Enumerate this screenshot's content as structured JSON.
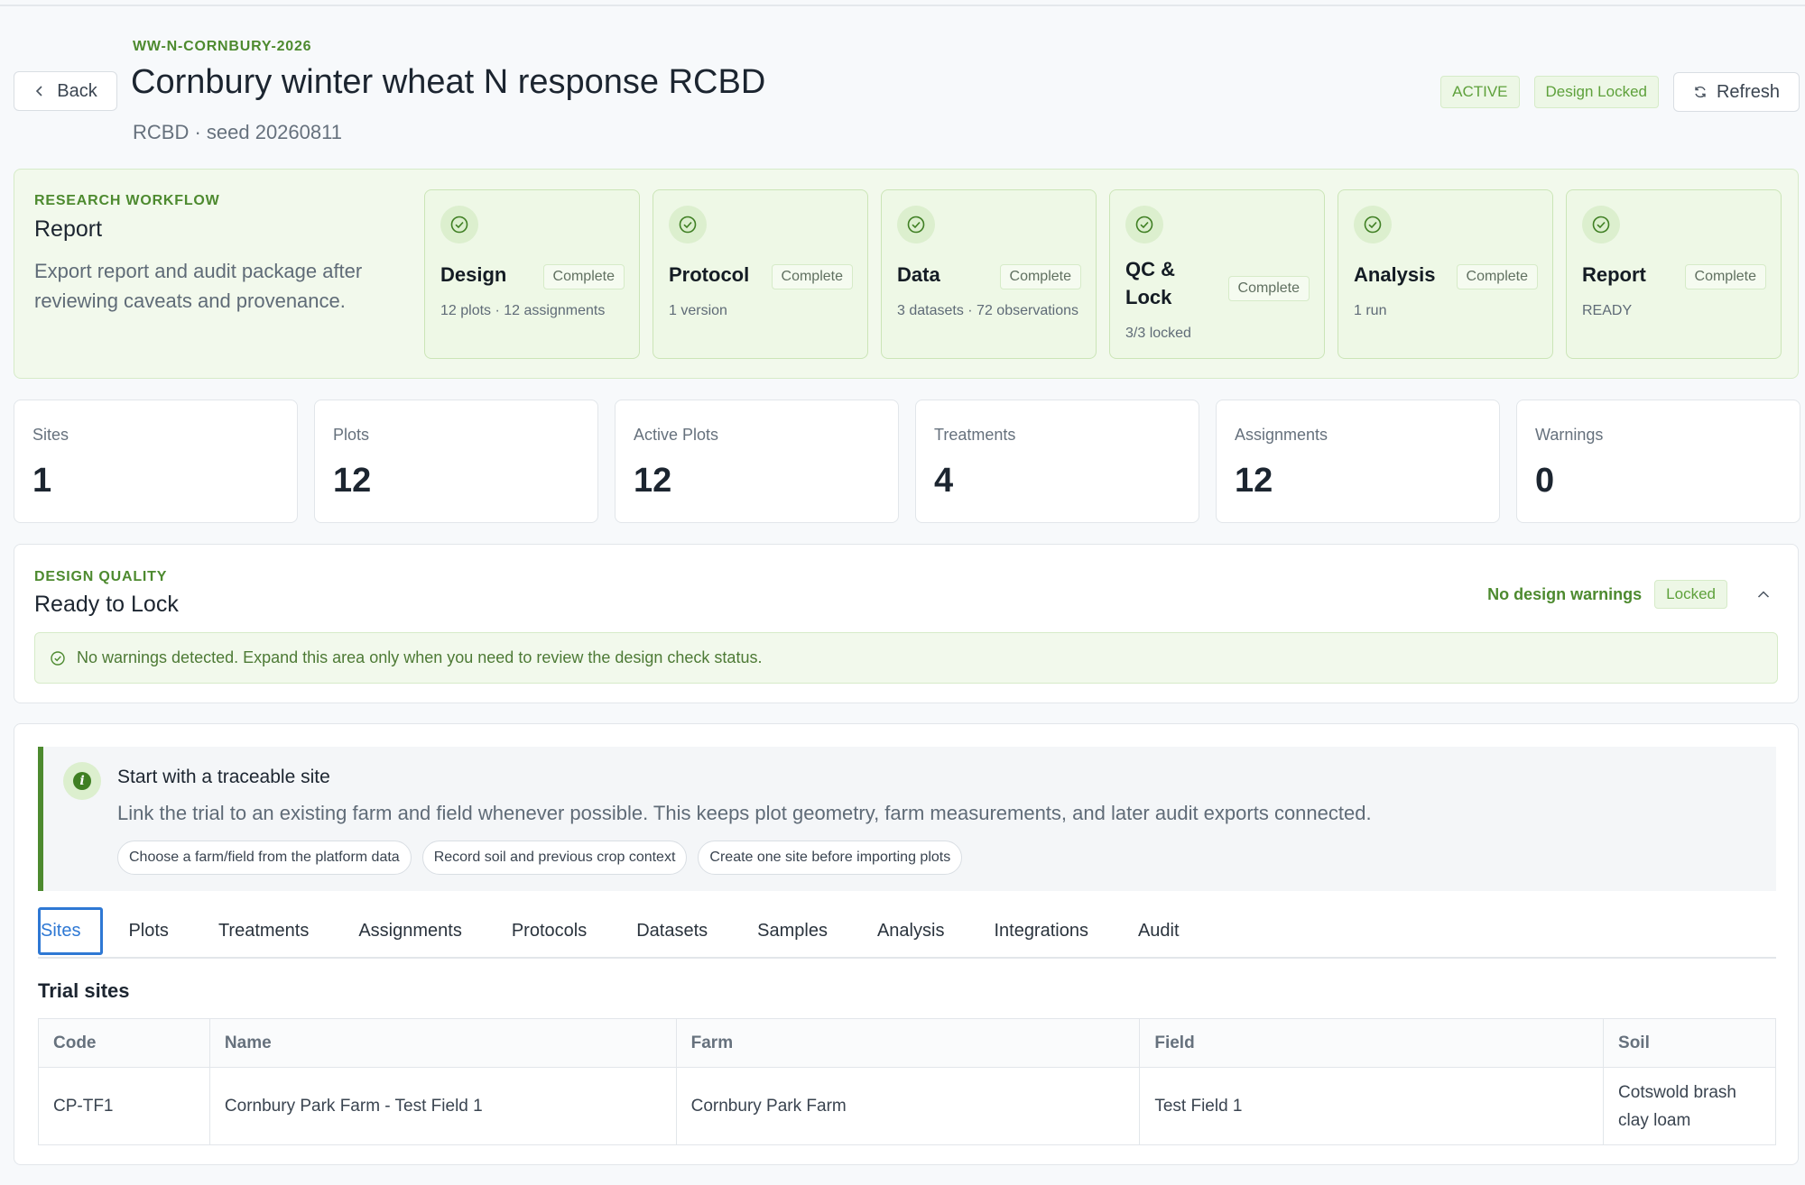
{
  "header": {
    "back_label": "Back",
    "trial_code": "WW-N-CORNBURY-2026",
    "title": "Cornbury winter wheat N response RCBD",
    "subtitle": "RCBD · seed 20260811",
    "status_badge": "ACTIVE",
    "design_badge": "Design Locked",
    "refresh_label": "Refresh"
  },
  "workflow": {
    "eyebrow": "RESEARCH WORKFLOW",
    "title": "Report",
    "description": "Export report and audit package after reviewing caveats and provenance.",
    "steps": [
      {
        "name": "Design",
        "status": "Complete",
        "meta": "12 plots · 12 assignments"
      },
      {
        "name": "Protocol",
        "status": "Complete",
        "meta": "1 version"
      },
      {
        "name": "Data",
        "status": "Complete",
        "meta": "3 datasets · 72 observations"
      },
      {
        "name": "QC & Lock",
        "status": "Complete",
        "meta": "3/3 locked"
      },
      {
        "name": "Analysis",
        "status": "Complete",
        "meta": "1 run"
      },
      {
        "name": "Report",
        "status": "Complete",
        "meta": "READY"
      }
    ]
  },
  "stats": [
    {
      "label": "Sites",
      "value": "1"
    },
    {
      "label": "Plots",
      "value": "12"
    },
    {
      "label": "Active Plots",
      "value": "12"
    },
    {
      "label": "Treatments",
      "value": "4"
    },
    {
      "label": "Assignments",
      "value": "12"
    },
    {
      "label": "Warnings",
      "value": "0"
    }
  ],
  "design_quality": {
    "eyebrow": "DESIGN QUALITY",
    "title": "Ready to Lock",
    "status_text": "No design warnings",
    "locked_badge": "Locked",
    "alert": "No warnings detected. Expand this area only when you need to review the design check status."
  },
  "hint": {
    "title": "Start with a traceable site",
    "text": "Link the trial to an existing farm and field whenever possible. This keeps plot geometry, farm measurements, and later audit exports connected.",
    "chips": [
      "Choose a farm/field from the platform data",
      "Record soil and previous crop context",
      "Create one site before importing plots"
    ]
  },
  "tabs": [
    "Sites",
    "Plots",
    "Treatments",
    "Assignments",
    "Protocols",
    "Datasets",
    "Samples",
    "Analysis",
    "Integrations",
    "Audit"
  ],
  "sites_table": {
    "title": "Trial sites",
    "columns": [
      "Code",
      "Name",
      "Farm",
      "Field",
      "Soil"
    ],
    "rows": [
      [
        "CP-TF1",
        "Cornbury Park Farm - Test Field 1",
        "Cornbury Park Farm",
        "Test Field 1",
        "Cotswold brash clay loam"
      ]
    ]
  },
  "colors": {
    "accent_green": "#4d8a2f",
    "active_tab_blue": "#2e78d4"
  }
}
